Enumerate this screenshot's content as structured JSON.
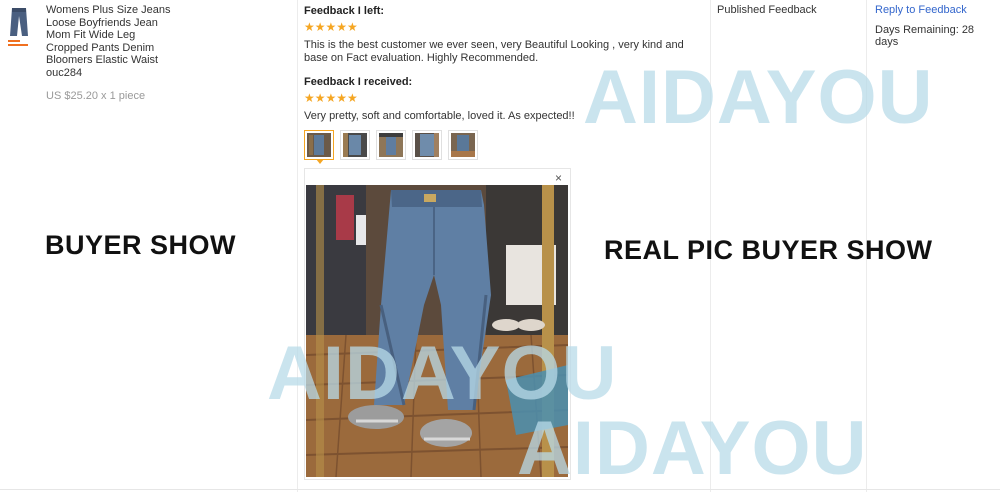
{
  "product": {
    "thumbnail": "jeans-thumbnail",
    "name": "Womens Plus Size Jeans Loose Boyfriends Jean Mom Fit Wide Leg Cropped Pants Denim Bloomers Elastic Waist ouc284",
    "price": "US $25.20 x 1 piece"
  },
  "feedback": {
    "left_title": "Feedback I left:",
    "left_stars": "★★★★★",
    "left_rating": 5,
    "left_text": "This is the best customer we ever seen, very Beautiful Looking , very kind and base on Fact evaluation. Highly Recommended.",
    "received_title": "Feedback I received:",
    "received_stars": "★★★★★",
    "received_rating": 5,
    "received_text": "Very pretty, soft and comfortable, loved it. As expected!!",
    "photo_count": 5,
    "close_label": "×"
  },
  "status": {
    "published": "Published Feedback",
    "reply_link": "Reply to Feedback",
    "days_remaining": "Days Remaining: 28 days"
  },
  "overlay": {
    "buyer_show": "BUYER SHOW",
    "real_pic": "REAL PIC BUYER SHOW",
    "watermark": "AIDAYOU"
  },
  "colors": {
    "star": "#f5a623",
    "link": "#3366cc",
    "watermark": "#b9dbe9"
  }
}
